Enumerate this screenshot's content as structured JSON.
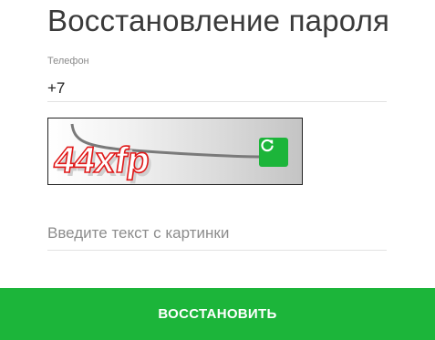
{
  "title": "Восстановление пароля",
  "phone": {
    "label": "Телефон",
    "value": "+7"
  },
  "captcha": {
    "text": "44xfp",
    "refresh_icon": "refresh-icon"
  },
  "captcha_input": {
    "placeholder": "Введите текст с картинки",
    "value": ""
  },
  "submit": {
    "label": "ВОССТАНОВИТЬ"
  },
  "colors": {
    "accent": "#1cb53a",
    "captcha_text": "#e01818"
  }
}
